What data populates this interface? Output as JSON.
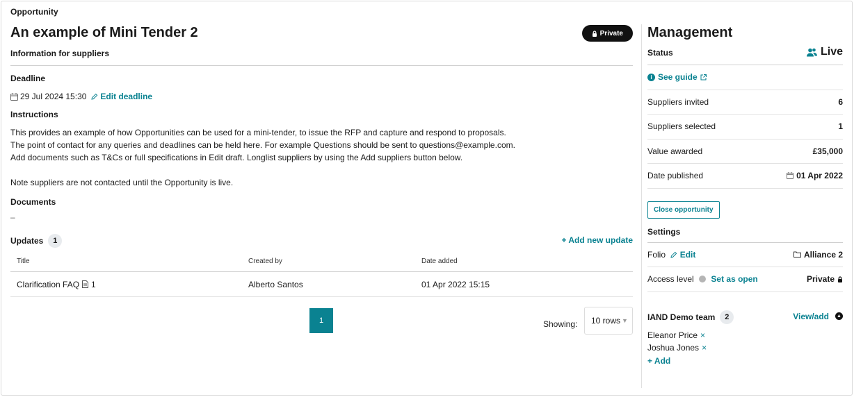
{
  "breadcrumb": "Opportunity",
  "title": "An example of Mini Tender 2",
  "private_badge": "Private",
  "info_heading": "Information for suppliers",
  "deadline": {
    "label": "Deadline",
    "value": "29 Jul 2024 15:30",
    "edit_label": "Edit deadline"
  },
  "instructions": {
    "label": "Instructions",
    "lines": [
      "This provides an example of how Opportunities can be used for a mini-tender, to issue the RFP and capture and respond to proposals.",
      "The point of contact for any queries and deadlines can be held here. For example Questions should be sent to questions@example.com.",
      "Add documents such as T&Cs or full specifications in Edit draft. Longlist suppliers by using the Add suppliers button below.",
      "",
      "Note suppliers are not contacted until the Opportunity is live."
    ]
  },
  "documents": {
    "label": "Documents",
    "empty": "–"
  },
  "updates": {
    "label": "Updates",
    "count": "1",
    "add_label": "+ Add new update",
    "columns": [
      "Title",
      "Created by",
      "Date added"
    ],
    "rows": [
      {
        "title": "Clarification FAQ",
        "attachments": "1",
        "created_by": "Alberto Santos",
        "date_added": "01 Apr 2022 15:15"
      }
    ]
  },
  "pagination": {
    "current_page": "1",
    "showing_label": "Showing:",
    "rows_value": "10 rows"
  },
  "management": {
    "title": "Management",
    "status_label": "Status",
    "status_value": "Live",
    "guide_label": "See guide",
    "suppliers_invited_label": "Suppliers invited",
    "suppliers_invited": "6",
    "suppliers_selected_label": "Suppliers selected",
    "suppliers_selected": "1",
    "value_awarded_label": "Value awarded",
    "value_awarded": "£35,000",
    "date_published_label": "Date published",
    "date_published": "01 Apr 2022",
    "close_label": "Close opportunity"
  },
  "settings": {
    "label": "Settings",
    "folio_label": "Folio",
    "folio_edit": "Edit",
    "folio_value": "Alliance 2",
    "access_label": "Access level",
    "access_link": "Set as open",
    "access_value": "Private"
  },
  "team": {
    "name": "IAND Demo team",
    "count": "2",
    "view_add": "View/add",
    "members": [
      "Eleanor Price",
      "Joshua Jones"
    ],
    "add_label": "+ Add"
  },
  "colors": {
    "accent": "#0a8291",
    "badge_bg": "#111111"
  }
}
